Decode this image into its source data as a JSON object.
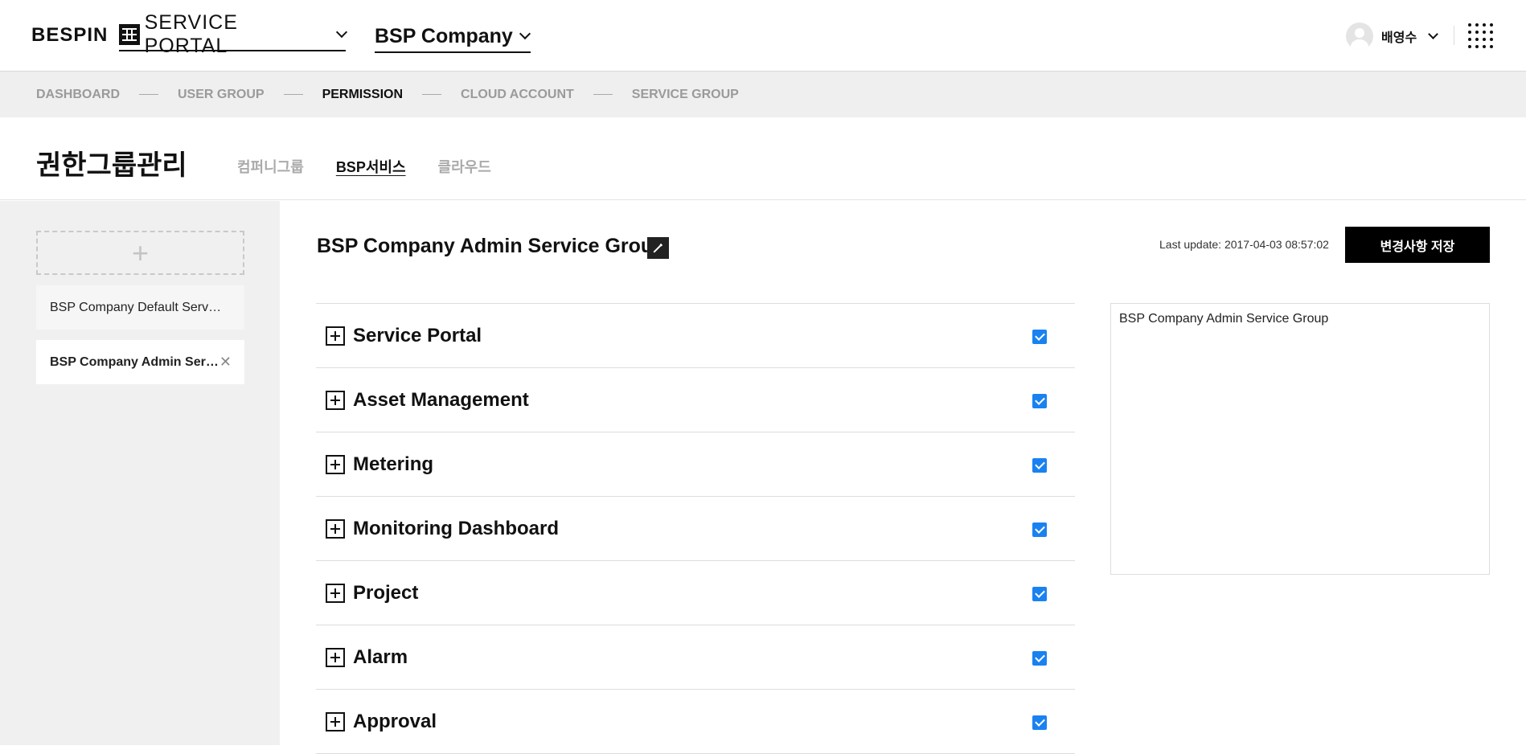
{
  "header": {
    "logo": "BESPIN",
    "portal_label": "SERVICE PORTAL",
    "company_label": "BSP Company",
    "user_name": "배영수"
  },
  "steps": [
    {
      "label": "DASHBOARD",
      "active": false
    },
    {
      "label": "USER GROUP",
      "active": false
    },
    {
      "label": "PERMISSION",
      "active": true
    },
    {
      "label": "CLOUD ACCOUNT",
      "active": false
    },
    {
      "label": "SERVICE GROUP",
      "active": false
    }
  ],
  "page": {
    "title": "권한그룹관리",
    "subtabs": [
      {
        "label": "컴퍼니그룹",
        "active": false
      },
      {
        "label": "BSP서비스",
        "active": true
      },
      {
        "label": "클라우드",
        "active": false
      }
    ]
  },
  "sidebar": {
    "add_symbol": "+",
    "groups": [
      {
        "label": "BSP Company Default Service Group",
        "selected": false
      },
      {
        "label": "BSP Company Admin Service Group",
        "selected": true
      }
    ],
    "remove_symbol": "✕"
  },
  "main": {
    "group_title": "BSP Company Admin Service Group",
    "last_update": "Last update: 2017-04-03 08:57:02",
    "save_label": "변경사항 저장",
    "description": "BSP Company Admin Service Group",
    "permissions": [
      {
        "label": "Service Portal",
        "checked": true
      },
      {
        "label": "Asset Management",
        "checked": true
      },
      {
        "label": "Metering",
        "checked": true
      },
      {
        "label": "Monitoring Dashboard",
        "checked": true
      },
      {
        "label": "Project",
        "checked": true
      },
      {
        "label": "Alarm",
        "checked": true
      },
      {
        "label": "Approval",
        "checked": true
      }
    ]
  },
  "colors": {
    "checkbox": "#1a82f0",
    "save_button": "#000000",
    "sidebar_bg": "#f0f0f0",
    "steps_bg": "#efefef"
  }
}
